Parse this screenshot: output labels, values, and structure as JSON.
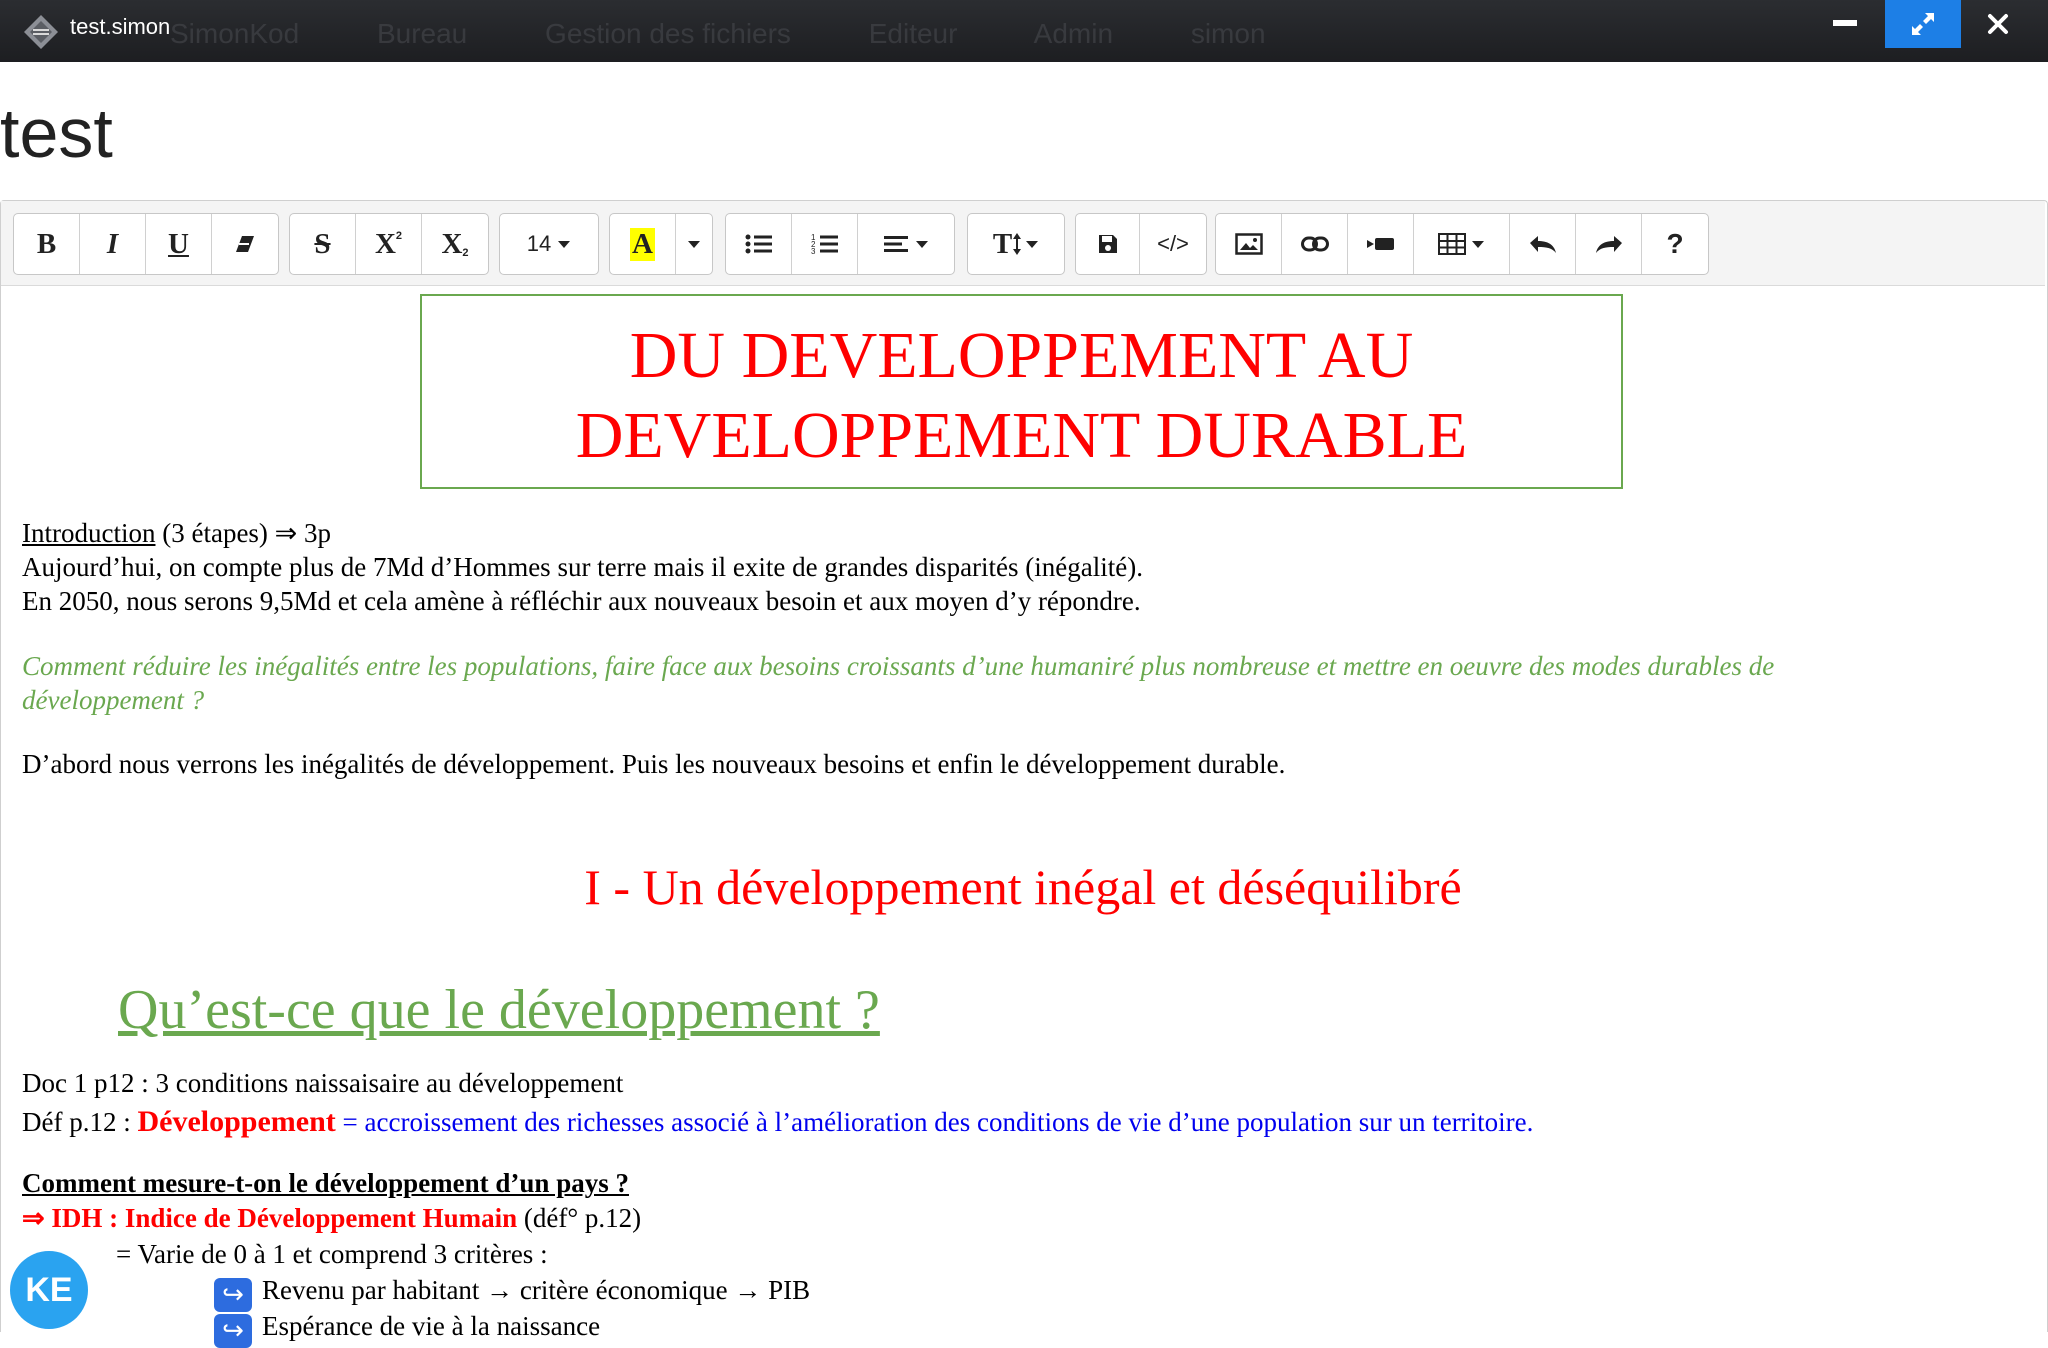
{
  "window": {
    "title": "test.simon",
    "background_menu": [
      "SimonKod",
      "Bureau",
      "Gestion des fichiers",
      "Editeur",
      "Admin",
      "simon"
    ]
  },
  "document": {
    "name": "test"
  },
  "toolbar": {
    "bold": "B",
    "italic": "I",
    "underline": "U",
    "strike": "S",
    "superscript": "X",
    "subscript": "X",
    "font_size": "14",
    "highlight": "A",
    "text_style": "T",
    "code": "</>",
    "help": "?"
  },
  "content": {
    "main_title_line1": "DU DEVELOPPEMENT AU",
    "main_title_line2": "DEVELOPPEMENT DURABLE",
    "intro_label": "Introduction",
    "intro_rest": " (3 étapes) ⇒ 3p",
    "intro_line2": "Aujourd’hui, on compte plus de 7Md d’Hommes sur terre mais il exite de grandes disparités (inégalité).",
    "intro_line3": "En 2050, nous serons 9,5Md et cela amène à réfléchir aux nouveaux besoin et aux moyen d’y répondre.",
    "question_line1": "Comment réduire les inégalités entre les populations, faire face aux besoins croissants d’une humaniré plus nombreuse et mettre en oeuvre des modes durables de",
    "question_line2": "développement ?",
    "plan": "D’abord nous verrons les inégalités de développement. Puis les nouveaux besoins et enfin le développement durable.",
    "section_title": "I - Un développement inégal et déséquilibré",
    "sub_title": "Qu’est-ce que le développement ?",
    "doc_line": "Doc 1 p12 : 3 conditions naissaisaire au développement",
    "def_prefix": "Déf p.12 : ",
    "def_term": "Développement",
    "def_text": " = accroissement des richesses associé à l’amélioration des conditions de vie d’une population sur un territoire.",
    "measure_q": "Comment mesure-t-on le développement d’un pays ?",
    "idh_label": "⇒ IDH : Indice de Développement Humain",
    "idh_ref": " (déf° p.12)",
    "idh_desc": "= Varie de 0 à 1 et comprend 3 critères :",
    "criteria": [
      "Revenu par habitant → critère économique → PIB",
      "Espérance de vie à la naissance"
    ]
  },
  "badge": "KE",
  "colors": {
    "accent": "#1d7fe6",
    "title_red": "#ff0000",
    "green": "#6aa84f",
    "blue": "#0000ee"
  }
}
